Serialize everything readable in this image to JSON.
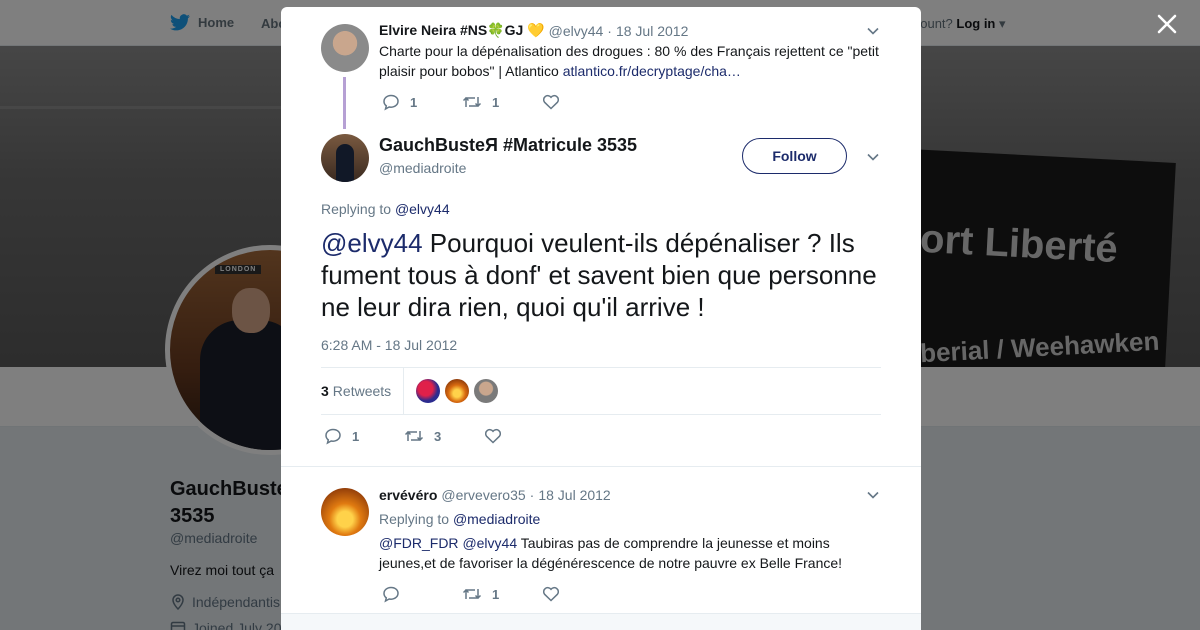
{
  "nav": {
    "home": "Home",
    "about": "Abo",
    "account_q": "account?",
    "login": "Log in"
  },
  "banner": {
    "sign_top": "ort Liberté",
    "sign_bottom": "berial / Weehawken"
  },
  "profile": {
    "avatar_sign": "LONDON",
    "name": "GauchBuste 3535",
    "handle": "@mediadroite",
    "bio": "Virez moi tout ça",
    "location": "Indépendantis",
    "joined": "Joined July 20"
  },
  "tweet1": {
    "name": "Elvire Neira #NS🍀GJ 💛",
    "handle": "@elvy44",
    "sep": "·",
    "date": "18 Jul 2012",
    "text": "Charte pour la dépénalisation des drogues : 80 % des Français rejettent ce \"petit plaisir pour bobos\" | Atlantico ",
    "link": "atlantico.fr/decryptage/cha…",
    "replies": "1",
    "retweets": "1"
  },
  "main": {
    "name": "GauchBusteЯ #Matricule 3535",
    "handle": "@mediadroite",
    "follow": "Follow",
    "replying_label": "Replying to ",
    "replying_handle": "@elvy44",
    "mention": "@elvy44",
    "text": " Pourquoi veulent-ils dépénaliser ? Ils fument tous à donf' et savent bien que personne ne leur dira rien, quoi qu'il arrive !",
    "datetime": "6:28 AM - 18 Jul 2012",
    "retweet_count": "3",
    "retweet_label": "Retweets",
    "replies": "1",
    "retweets": "3"
  },
  "tweet3": {
    "name": "ervévéro",
    "handle": "@ervevero35",
    "sep": "·",
    "date": "18 Jul 2012",
    "replying_label": "Replying to ",
    "replying_handle": "@mediadroite",
    "mention1": "@FDR_FDR",
    "mention2": "@elvy44",
    "text": " Taubiras pas de comprendre la jeunesse et moins jeunes,et de favoriser la dégénérescence de notre pauvre ex Belle France!",
    "retweets": "1"
  },
  "colors": {
    "link": "#1c2b6b",
    "muted": "#657786",
    "thread": "#b6a0d4",
    "twitter_blue": "#1da1f2"
  }
}
